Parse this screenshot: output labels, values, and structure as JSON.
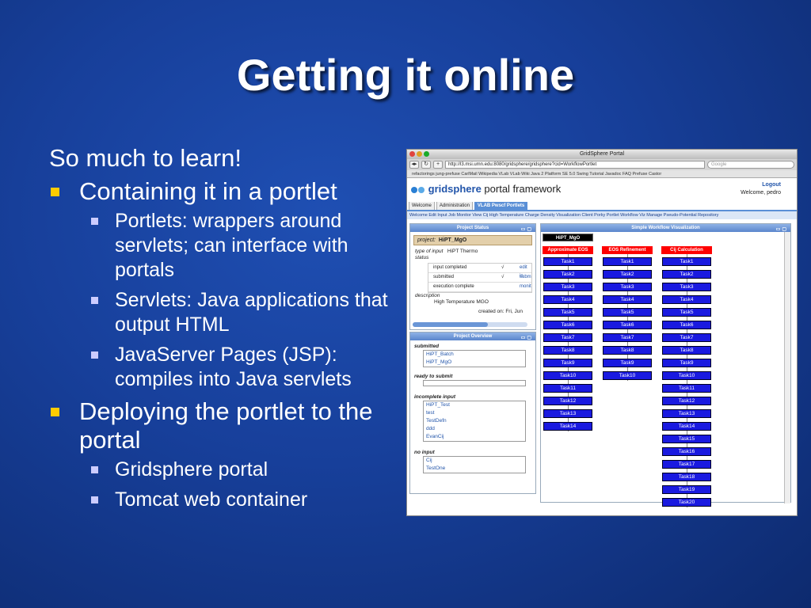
{
  "slide": {
    "title": "Getting it online",
    "intro": "So much to learn!",
    "bullets": [
      {
        "text": "Containing it in a portlet",
        "subs": [
          "Portlets: wrappers around servlets; can interface with portals",
          "Servlets: Java applications that output HTML",
          "JavaServer Pages (JSP): compiles into Java servlets"
        ]
      },
      {
        "text": "Deploying the portlet to the portal",
        "subs": [
          "Gridsphere portal",
          "Tomcat web container"
        ]
      }
    ],
    "bullet_color": "#ffcc00",
    "sub_bullet_color": "#ccccff"
  },
  "browser": {
    "window_title": "GridSphere Portal",
    "url": "http://l3.msi.umn.edu:8080/gridsphere/gridsphere?cid=WorkflowPortlet",
    "search_placeholder": "Google",
    "bookmarks": "refactorings   jung-prefuse   CarlMail   Wikipedia   VLab   VLab Wiki   Java 2 Platform SE 5.0   Swing Tutorial   Javadoc FAQ   Prefuse   Castor"
  },
  "portal": {
    "logo_brand": "gridsphere",
    "logo_rest": " portal framework",
    "logout": "Logout",
    "welcome": "Welcome, pedro",
    "tabs": [
      "Welcome",
      "Administration",
      "VLAB Pwscf Portlets"
    ],
    "subnav": "Welcome  Edit Input  Job Monitor  View Cij  High Temperature  Charge Density Visualization Client  Porky Portlet  Workflow Viz  Manage Pseudo-Potential Repository",
    "project_status": {
      "header": "Project Status",
      "project_label": "project:",
      "project_name": "HiPT_MgO",
      "type_label": "type of input",
      "type_value": "HiPT Thermo",
      "status_label": "status",
      "rows": [
        {
          "name": "input completed",
          "check": "√",
          "link": "edit in"
        },
        {
          "name": "submitted",
          "check": "√",
          "link": "subm"
        },
        {
          "name": "execution complete",
          "check": "",
          "link": "monit"
        }
      ],
      "description_label": "description",
      "description": "High Temperature MGO",
      "created": "created on: Fri, Jun"
    },
    "project_overview": {
      "header": "Project Overview",
      "groups": [
        {
          "label": "submitted",
          "items": [
            "HiPT_Batch",
            "HiPT_MgO"
          ]
        },
        {
          "label": "ready to submit",
          "items": []
        },
        {
          "label": "incomplete input",
          "items": [
            "HiPT_Test",
            "test",
            "TestDefn",
            "ddd",
            "EvanCij"
          ]
        },
        {
          "label": "no input",
          "items": [
            "Cij",
            "TestOne"
          ]
        }
      ]
    },
    "workflow": {
      "header": "Simple Workflow Visualization",
      "root": "HiPT_MgO",
      "columns": [
        {
          "name": "Approximate EOS",
          "tasks": [
            "Task1",
            "Task2",
            "Task3",
            "Task4",
            "Task5",
            "Task6",
            "Task7",
            "Task8",
            "Task9",
            "Task10",
            "Task11",
            "Task12",
            "Task13",
            "Task14"
          ]
        },
        {
          "name": "EOS Refinement",
          "tasks": [
            "Task1",
            "Task2",
            "Task3",
            "Task4",
            "Task5",
            "Task6",
            "Task7",
            "Task8",
            "Task9",
            "Task10"
          ]
        },
        {
          "name": "Cij Calculation",
          "tasks": [
            "Task1",
            "Task2",
            "Task3",
            "Task4",
            "Task5",
            "Task6",
            "Task7",
            "Task8",
            "Task9",
            "Task10",
            "Task11",
            "Task12",
            "Task13",
            "Task14",
            "Task15",
            "Task16",
            "Task17",
            "Task18",
            "Task19",
            "Task20"
          ]
        }
      ],
      "column_color": "#ff0000",
      "task_color": "#1a1ae0"
    }
  }
}
